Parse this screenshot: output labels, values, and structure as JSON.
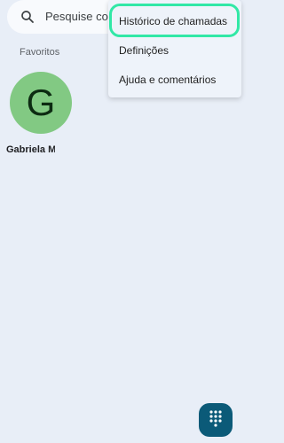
{
  "search": {
    "placeholder": "Pesquise contatos",
    "icon": "search-icon"
  },
  "favorites": {
    "label": "Favoritos",
    "contacts": [
      {
        "initial": "G",
        "name": "Gabriela Martins",
        "avatar_color": "#82c983"
      }
    ]
  },
  "menu": {
    "items": [
      {
        "label": "Histórico de chamadas",
        "highlighted": true
      },
      {
        "label": "Definições"
      },
      {
        "label": "Ajuda e comentários"
      }
    ],
    "highlight_color": "#31e8a6"
  },
  "fab": {
    "icon": "dialpad-icon",
    "color": "#0b5a78"
  },
  "colors": {
    "background": "#e8eef7",
    "menu_background": "#eef3fa"
  }
}
